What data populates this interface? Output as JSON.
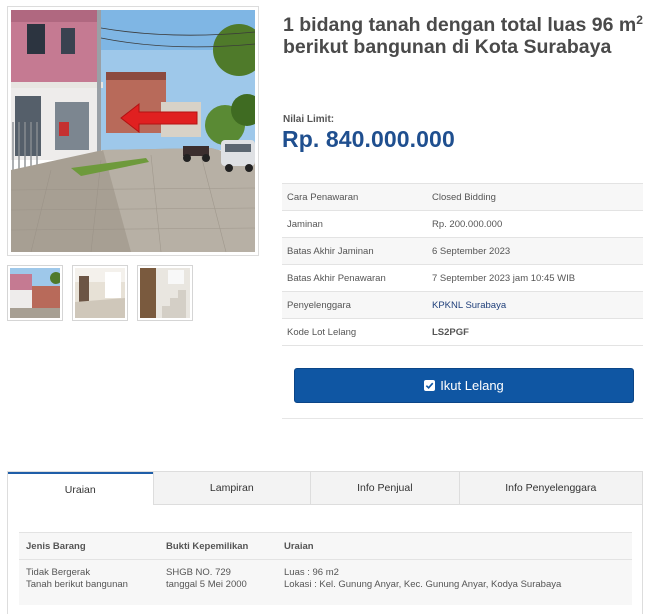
{
  "gallery": {
    "main_photo": "street-house-photo",
    "thumbnails": [
      "house-exterior-thumb",
      "interior-room-thumb",
      "staircase-thumb"
    ]
  },
  "listing": {
    "title_pre": "1 bidang tanah dengan total luas 96 m",
    "title_sup": "2",
    "title_post": " berikut bangunan di Kota Surabaya",
    "limit_label": "Nilai Limit:",
    "limit_value": "Rp. 840.000.000"
  },
  "info": {
    "rows": [
      {
        "key": "Cara Penawaran",
        "value": "Closed Bidding"
      },
      {
        "key": "Jaminan",
        "value": "Rp. 200.000.000"
      },
      {
        "key": "Batas Akhir Jaminan",
        "value": "6 September 2023"
      },
      {
        "key": "Batas Akhir Penawaran",
        "value": "7 September 2023 jam 10:45 WIB"
      },
      {
        "key": "Penyelenggara",
        "value": "KPKNL Surabaya"
      },
      {
        "key": "Kode Lot Lelang",
        "value": "LS2PGF"
      }
    ]
  },
  "bid_button": {
    "label": "Ikut Lelang",
    "icon": "check-square-icon"
  },
  "tabs": [
    {
      "label": "Uraian",
      "active": true
    },
    {
      "label": "Lampiran",
      "active": false
    },
    {
      "label": "Info Penjual",
      "active": false
    },
    {
      "label": "Info Penyelenggara",
      "active": false
    }
  ],
  "details": {
    "headers": [
      "Jenis Barang",
      "Bukti Kepemilikan",
      "Uraian"
    ],
    "row": {
      "jenis_1": "Tidak Bergerak",
      "jenis_2": "Tanah berikut bangunan",
      "bukti_1": "SHGB NO. 729",
      "bukti_2": "tanggal 5 Mei 2000",
      "uraian_1": "Luas : 96 m2",
      "uraian_2": "Lokasi : Kel. Gunung Anyar, Kec. Gunung Anyar, Kodya Surabaya"
    }
  },
  "colors": {
    "accent": "#0f56a3",
    "price": "#1f4f8f",
    "pointer_arrow": "#e02020"
  }
}
